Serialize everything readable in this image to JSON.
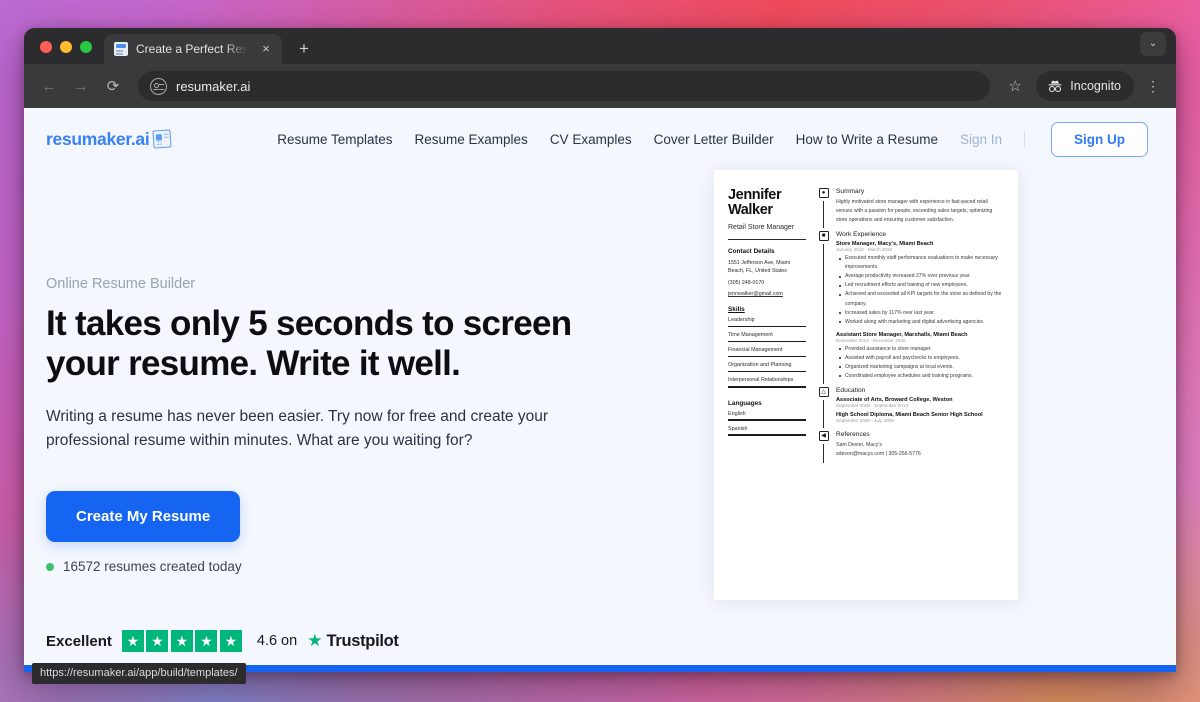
{
  "browser": {
    "tab": {
      "title": "Create a Perfect Resume | Fre",
      "favicon": "document-icon",
      "close": "×"
    },
    "newtab_label": "+",
    "window_chevron": "⌄",
    "toolbar": {
      "back": "←",
      "forward": "→",
      "reload": "⟳",
      "site_icon": "page-settings-icon",
      "url": "resumaker.ai",
      "bookmark": "☆",
      "incognito_label": "Incognito",
      "menu": "⋮"
    },
    "status_url": "https://resumaker.ai/app/build/templates/"
  },
  "site": {
    "logo_text": "resumaker.ai",
    "nav": [
      {
        "label": "Resume Templates",
        "muted": false
      },
      {
        "label": "Resume Examples",
        "muted": false
      },
      {
        "label": "CV Examples",
        "muted": false
      },
      {
        "label": "Cover Letter Builder",
        "muted": false
      },
      {
        "label": "How to Write a Resume",
        "muted": false
      },
      {
        "label": "Sign In",
        "muted": true
      }
    ],
    "signup_label": "Sign Up"
  },
  "hero": {
    "eyebrow": "Online Resume Builder",
    "headline": "It takes only 5 seconds to screen your resume. Write it well.",
    "subcopy": "Writing a resume has never been easier. Try now for free and create your professional resume within minutes. What are you waiting for?",
    "cta_label": "Create My Resume",
    "counter": "16572 resumes created today"
  },
  "trustpilot": {
    "word": "Excellent",
    "star_count": 5,
    "star_glyph": "★",
    "score_text": "4.6 on",
    "brand": "Trustpilot",
    "brand_star": "★",
    "green": "#00b67a"
  },
  "resume": {
    "name": "Jennifer Walker",
    "role": "Retail Store Manager",
    "contact": {
      "heading": "Contact Details",
      "address_line1": "1551 Jefferson Ave, Miami",
      "address_line2": "Beach, FL, United States",
      "phone": "(305) 248-0170",
      "email": "jennwalker@gmail.com"
    },
    "skills": {
      "heading": "Skills",
      "items": [
        "Leadership",
        "Time Management",
        "Financial Management",
        "Organization and Planning",
        "Interpersonal Relationships"
      ]
    },
    "languages": {
      "heading": "Languages",
      "items": [
        "English",
        "Spanish"
      ]
    },
    "summary": {
      "heading": "Summary",
      "icon": "person-badge-icon",
      "text": "Highly motivated store manager with experience in fast-paced retail venues with a passion for people, exceeding sales targets, optimizing store operations and ensuring customer satisfaction."
    },
    "experience": {
      "heading": "Work Experience",
      "icon": "briefcase-icon",
      "jobs": [
        {
          "title": "Store Manager, Macy's, Miami Beach",
          "dates": "January 2016 - March 2020",
          "bullets": [
            "Executed monthly staff performance evaluations to make necessary improvements.",
            "Average productivity increased 27% over previous year.",
            "Led recruitment efforts and training of new employees.",
            "Achieved and exceeded all KPI targets for the store as defined by the company.",
            "Increased sales by 117% over last year.",
            "Worked along with marketing and digital advertising agencies."
          ]
        },
        {
          "title": "Assistant Store Manager, Marshalls, Miami Beach",
          "dates": "November 2013 - December 2020",
          "bullets": [
            "Provided assistance to store manager.",
            "Assisted with payroll and paychecks to employees.",
            "Organized marketing campaigns at local events.",
            "Coordinated employee schedules and training programs."
          ]
        }
      ]
    },
    "education": {
      "heading": "Education",
      "icon": "graduation-cap-icon",
      "entries": [
        {
          "title": "Associate of Arts, Broward College, Weston",
          "dates": "September 2009 - September 2013"
        },
        {
          "title": "High School Diploma, Miami Beach Senior High School",
          "dates": "September 2005 - July 2009"
        }
      ]
    },
    "references": {
      "heading": "References",
      "icon": "megaphone-icon",
      "name": "Sam Devon, Macy's",
      "detail": "sdevon@macys.com | 305-256-5776"
    }
  },
  "colors": {
    "brand_blue": "#1565f2",
    "page_bg": "#f4f7fd",
    "trust_green": "#00b67a",
    "counter_dot": "#3ec06a"
  }
}
